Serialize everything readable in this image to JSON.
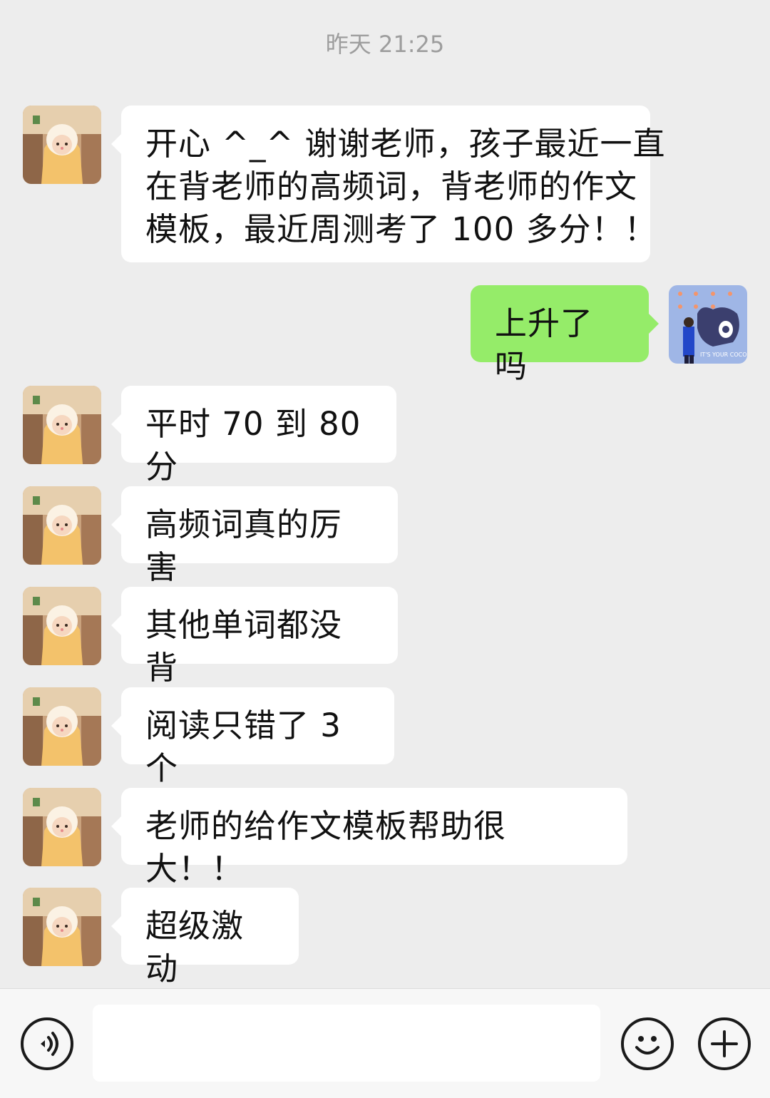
{
  "chat": {
    "timestamp": "昨天 21:25",
    "messages": [
      {
        "from": "other",
        "text": "开心 ^_^ 谢谢老师，孩子最近一直\n在背老师的高频词，背老师的作文\n模板，最近周测考了 100 多分！！"
      },
      {
        "from": "me",
        "text": "上升了吗"
      },
      {
        "from": "other",
        "text": "平时 70 到 80 分"
      },
      {
        "from": "other",
        "text": "高频词真的厉害"
      },
      {
        "from": "other",
        "text": "其他单词都没背"
      },
      {
        "from": "other",
        "text": "阅读只错了 3 个"
      },
      {
        "from": "other",
        "text": "老师的给作文模板帮助很大！！"
      },
      {
        "from": "other",
        "text": "超级激动"
      }
    ]
  },
  "my_avatar": {
    "caption": "IT'S YOUR COCO"
  },
  "input_bar": {
    "voice_icon": "voice-icon",
    "emoji_icon": "emoji-icon",
    "plus_icon": "plus-icon",
    "input_value": ""
  },
  "colors": {
    "background": "#ededed",
    "incoming_bubble": "#ffffff",
    "outgoing_bubble": "#95ec69"
  }
}
